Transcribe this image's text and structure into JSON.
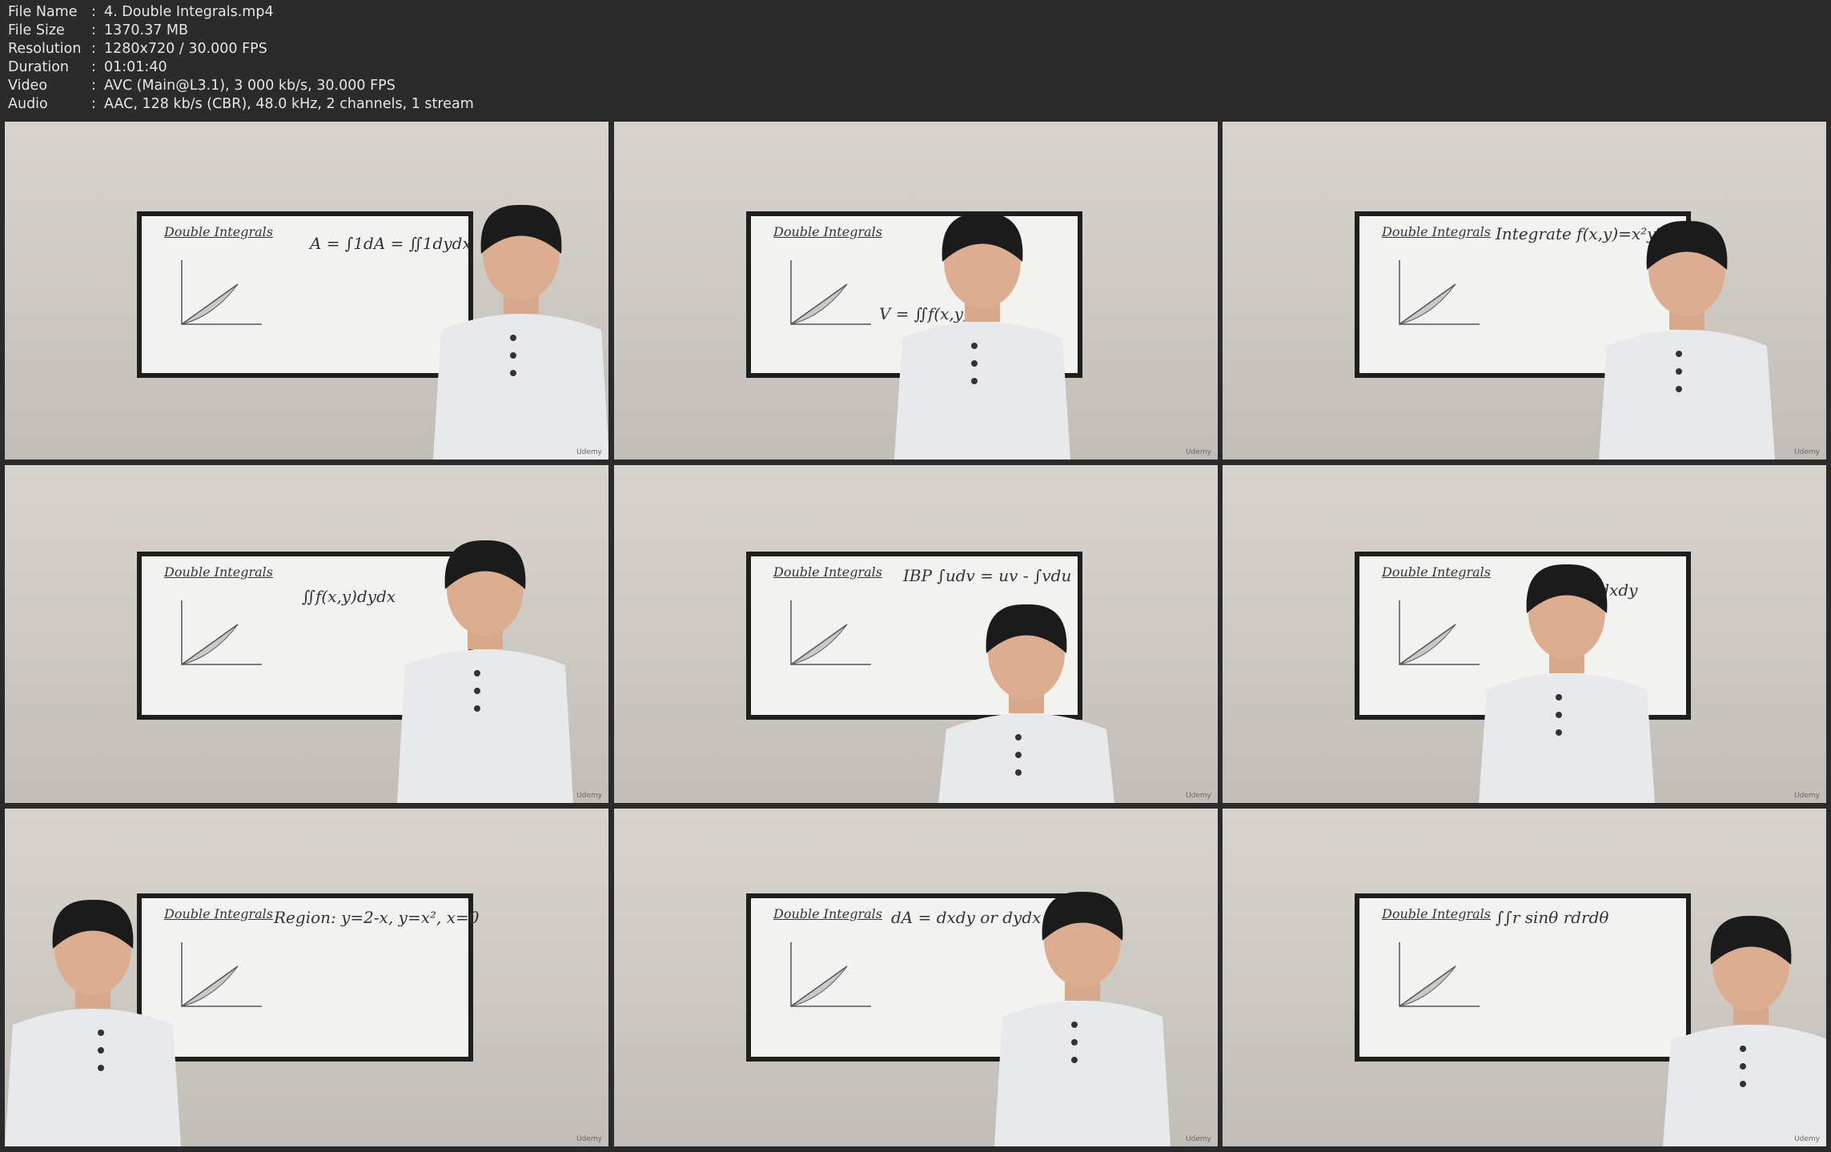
{
  "info": [
    {
      "key": "File Name",
      "value": "4. Double Integrals.mp4"
    },
    {
      "key": "File Size",
      "value": "1370.37 MB"
    },
    {
      "key": "Resolution",
      "value": "1280x720 / 30.000 FPS"
    },
    {
      "key": "Duration",
      "value": "01:01:40"
    },
    {
      "key": "Video",
      "value": "AVC (Main@L3.1), 3 000 kb/s, 30.000 FPS"
    },
    {
      "key": "Audio",
      "value": "AAC, 128 kb/s (CBR), 48.0 kHz, 2 channels, 1 stream"
    }
  ],
  "separator": ":",
  "frames": [
    {
      "title": "Double Integrals",
      "equation": "A = ∫1dA = ∬1dydx"
    },
    {
      "title": "Double Integrals",
      "equation": "V = ∬f(x,y)"
    },
    {
      "title": "Double Integrals",
      "equation": "Integrate f(x,y)=x²y²"
    },
    {
      "title": "Double Integrals",
      "equation": "∬f(x,y)dydx"
    },
    {
      "title": "Double Integrals",
      "equation": "IBP ∫udv = uv - ∫vdu"
    },
    {
      "title": "Double Integrals",
      "equation": "= ∫∫eˣ dxdy"
    },
    {
      "title": "Double Integrals",
      "equation": "Region: y=2-x, y=x², x=0"
    },
    {
      "title": "Double Integrals",
      "equation": "dA = dxdy or dydx"
    },
    {
      "title": "Double Integrals",
      "equation": "∫∫r sinθ rdrdθ"
    }
  ],
  "watermark": "Udemy"
}
